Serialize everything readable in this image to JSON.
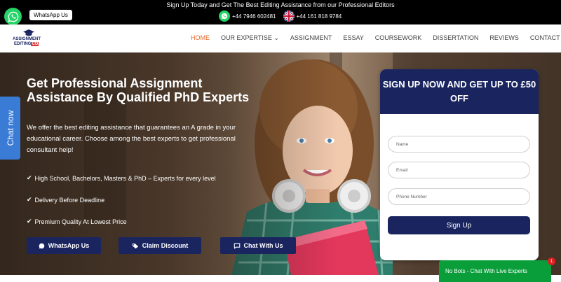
{
  "topbar": {
    "announcement": "Sign Up Today and Get The Best Editing Assistance from our Professional Editors",
    "phone_whatsapp": "+44 7946 602481",
    "phone_uk": "+44 161 818 9784"
  },
  "whatsapp_float": {
    "tooltip": "WhatsApp Us"
  },
  "logo": {
    "line1": "ASSIGNMENT",
    "line2a": "EDITING",
    "line2b": "CO"
  },
  "nav": {
    "items": [
      "HOME",
      "OUR EXPERTISE",
      "ASSIGNMENT",
      "ESSAY",
      "COURSEWORK",
      "DISSERTATION",
      "REVIEWS",
      "CONTACT"
    ],
    "chevron": "⌄"
  },
  "hero": {
    "title": "Get Professional Assignment Assistance By Qualified PhD Experts",
    "description": "We offer the best editing assistance  that guarantees an A grade in your educational career. Choose among the best experts to get professional consultant help!",
    "features": [
      "High School, Bachelors, Masters & PhD – Experts for every level",
      "Delivery Before Deadline",
      "Premium Quality At Lowest Price"
    ],
    "buttons": {
      "whatsapp": "WhatsApp Us",
      "discount": "Claim Discount",
      "chat": "Chat With Us"
    }
  },
  "chat_tab": {
    "label": "Chat now"
  },
  "signup": {
    "heading": "SIGN UP NOW AND GET UP TO £50 OFF",
    "name_placeholder": "Name",
    "email_placeholder": "Email",
    "phone_placeholder": "Phone Number",
    "button": "Sign Up"
  },
  "bot_bar": {
    "label": "No Bots - Chat With Live Experts",
    "badge": "1"
  },
  "colors": {
    "navy": "#1a2560",
    "whatsapp_green": "#25d366",
    "accent_orange": "#e66b2c",
    "chat_blue": "#3a7bd5",
    "bot_green": "#0a9e3a"
  }
}
